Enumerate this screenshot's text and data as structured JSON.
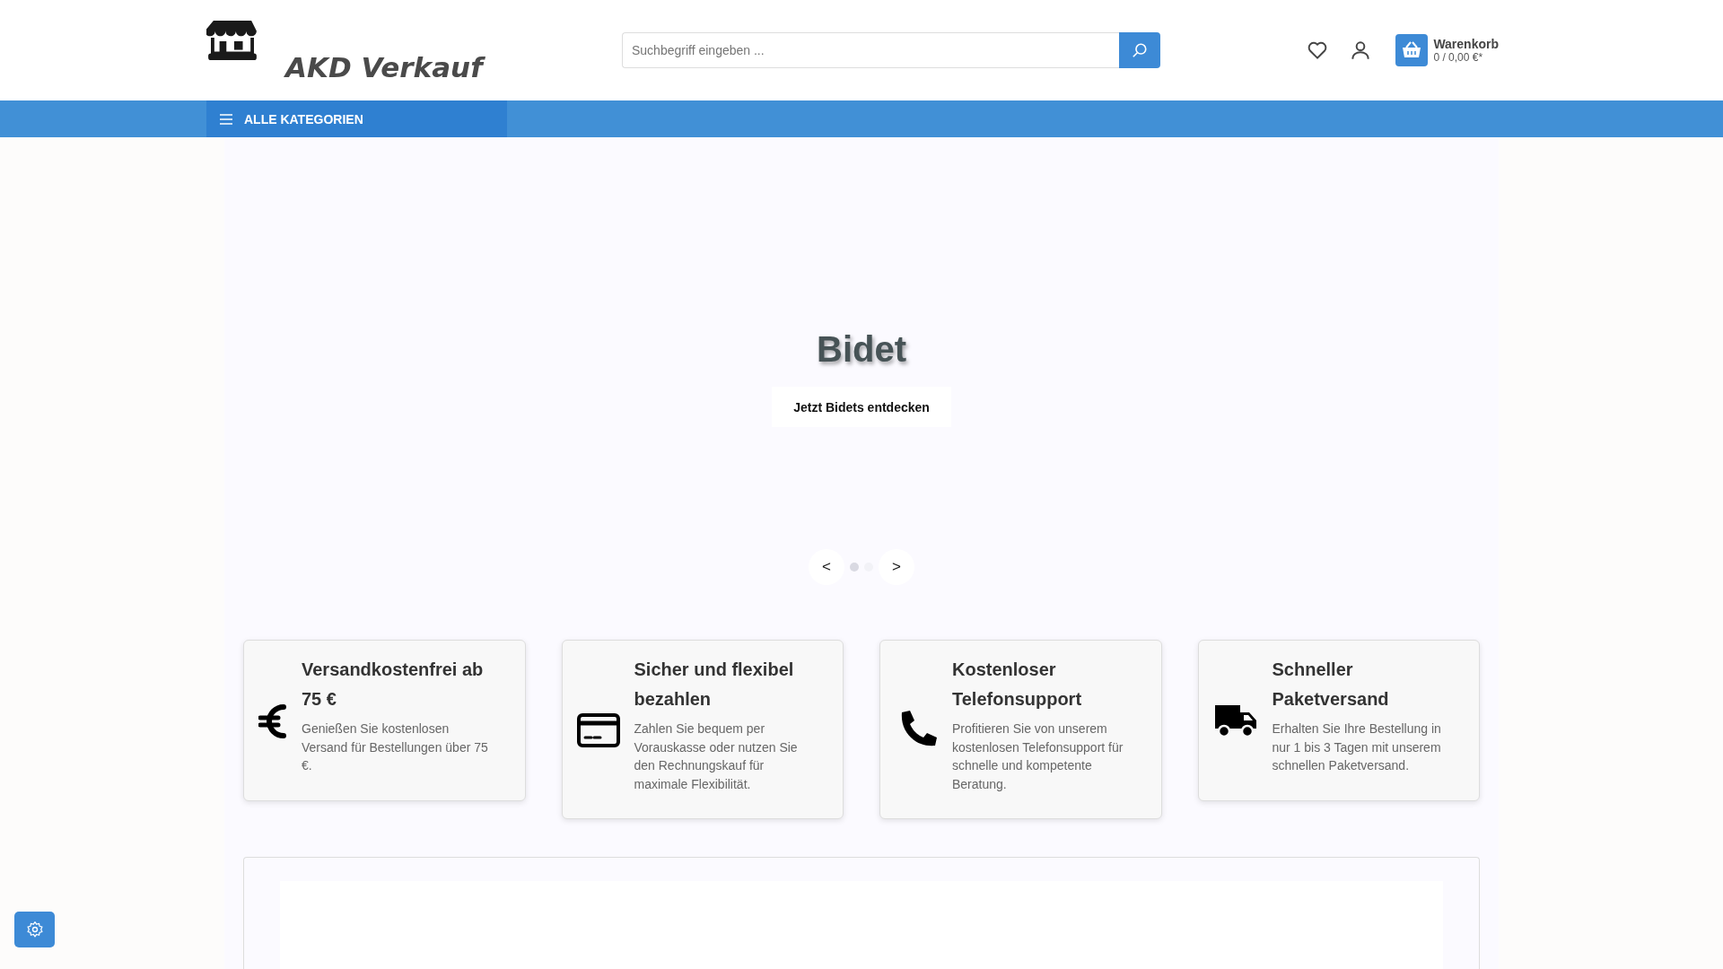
{
  "header": {
    "logo_text": "AKD Verkauf",
    "search": {
      "placeholder": "Suchbegriff eingeben ..."
    },
    "cart": {
      "label": "Warenkorb",
      "summary": "0 / 0,00 €*"
    }
  },
  "nav": {
    "categories_label": "ALLE KATEGORIEN"
  },
  "slider": {
    "title": "Bidet",
    "button": "Jetzt Bidets entdecken",
    "prev": "<",
    "next": ">",
    "dots": [
      {
        "selected": true
      },
      {
        "selected": false
      }
    ]
  },
  "features": [
    {
      "kind": "euro",
      "title": "Versandkostenfrei ab 75 €",
      "text": "Genießen Sie kostenlosen Versand für Bestellungen über 75 €."
    },
    {
      "kind": "card",
      "title": "Sicher und flexibel bezahlen",
      "text": "Zahlen Sie bequem per Vorauskasse oder nutzen Sie den Rechnungskauf für maximale Flexibilität."
    },
    {
      "kind": "phone",
      "title": "Kostenloser Telefonsupport",
      "text": "Profitieren Sie von unserem kostenlosen Telefonsupport für schnelle und kompetente Beratung."
    },
    {
      "kind": "truck",
      "title": "Schneller Paketversand",
      "text": "Erhalten Sie Ihre Bestellung in nur 1 bis 3 Tagen mit unserem schnellen Paketversand."
    }
  ]
}
